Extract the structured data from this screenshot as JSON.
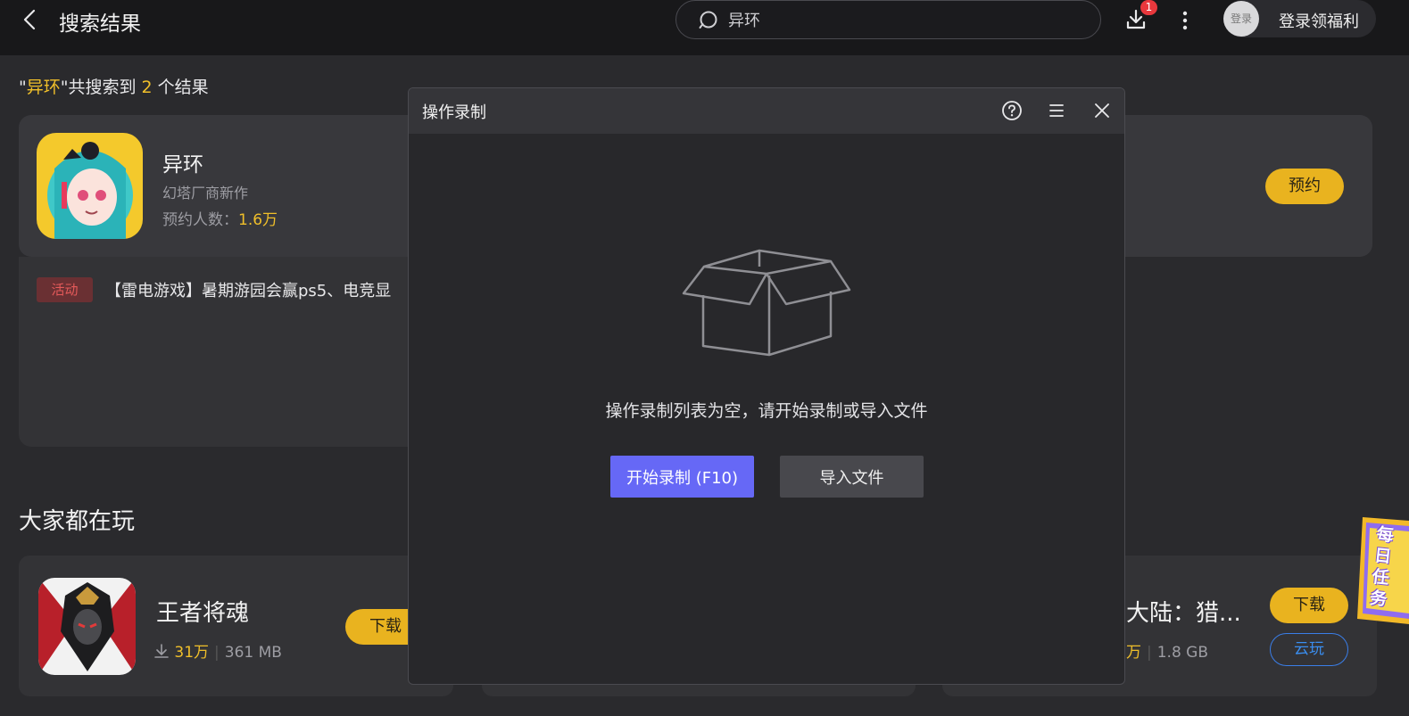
{
  "header": {
    "title": "搜索结果",
    "search_value": "异环",
    "download_badge": "1",
    "login_avatar_text": "登录",
    "login_label": "登录领福利"
  },
  "results": {
    "quote_open": "\"",
    "keyword": "异环",
    "quote_mid": "\"共搜索到 ",
    "count": "2",
    "suffix": " 个结果"
  },
  "top_result": {
    "name": "异环",
    "desc": "幻塔厂商新作",
    "reserve_label": "预约人数：",
    "reserve_count": "1.6万",
    "button": "预约",
    "activity_tag": "活动",
    "activity_text": "【雷电游戏】暑期游园会赢ps5、电竞显"
  },
  "section": {
    "title": "大家都在玩"
  },
  "games": [
    {
      "name": "王者将魂",
      "downloads": "31万",
      "size": "361 MB",
      "button": "下载"
    },
    {
      "name": "大陆：猎...",
      "downloads": "万",
      "size": "1.8 GB",
      "button": "下载",
      "cloud_button": "云玩"
    }
  ],
  "daily_task": "每日任务",
  "modal": {
    "title": "操作录制",
    "empty_text": "操作录制列表为空，请开始录制或导入文件",
    "start_button": "开始录制 (F10)",
    "import_button": "导入文件"
  },
  "colors": {
    "accent_yellow": "#e9b31f",
    "highlight_yellow": "#f0bf2a",
    "primary_purple": "#6668f6",
    "cloud_blue": "#3a8ef0",
    "badge_red": "#e8383d"
  }
}
